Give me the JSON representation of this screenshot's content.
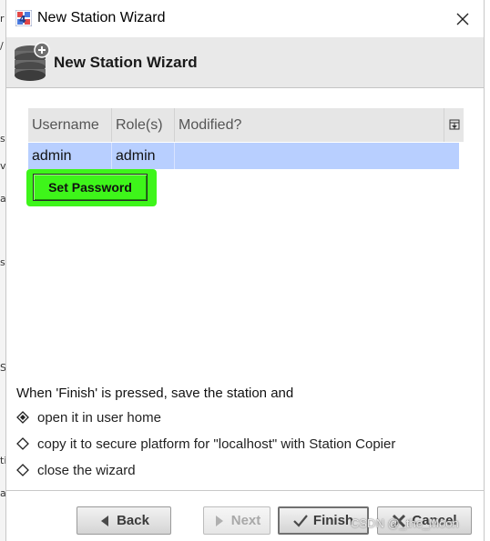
{
  "background": {
    "edge_chars": [
      "r",
      "/",
      "s",
      "vi",
      "s",
      "a",
      "S",
      "ti",
      "a"
    ]
  },
  "window": {
    "title": "New Station Wizard"
  },
  "header": {
    "title": "New Station Wizard"
  },
  "table": {
    "columns": [
      "Username",
      "Role(s)",
      "Modified?"
    ],
    "rows": [
      {
        "username": "admin",
        "roles": "admin",
        "modified": ""
      }
    ]
  },
  "set_password_label": "Set Password",
  "finish_section": {
    "prompt": "When 'Finish' is pressed, save the station and",
    "options": [
      {
        "label": "open it in user home",
        "selected": true
      },
      {
        "label": "copy it to secure platform for \"localhost\" with Station Copier",
        "selected": false
      },
      {
        "label": "close the wizard",
        "selected": false
      }
    ]
  },
  "buttons": {
    "back": "Back",
    "next": "Next",
    "finish": "Finish",
    "cancel": "Cancel"
  },
  "watermark": "CSDN @_the_Moon",
  "colors": {
    "highlight": "#3ef51a",
    "selected_row": "#b8cfff",
    "header_band": "#e9e9e9"
  }
}
